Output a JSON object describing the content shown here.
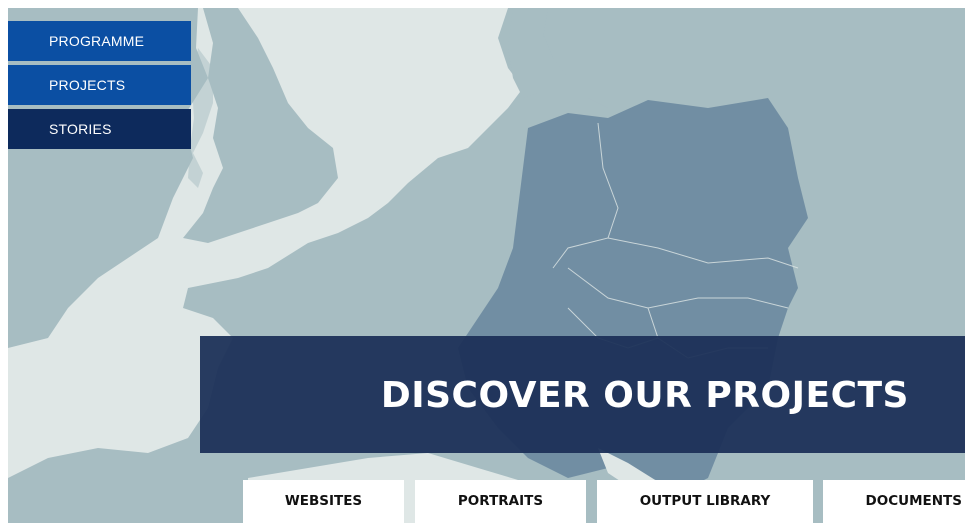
{
  "nav": {
    "items": [
      {
        "label": "PROGRAMME"
      },
      {
        "label": "PROJECTS"
      },
      {
        "label": "STORIES"
      }
    ]
  },
  "hero": {
    "title": "DISCOVER OUR PROJECTS"
  },
  "tabs": [
    {
      "label": "WEBSITES"
    },
    {
      "label": "PORTRAITS"
    },
    {
      "label": "OUTPUT LIBRARY"
    },
    {
      "label": "DOCUMENTS"
    }
  ],
  "colors": {
    "nav_blue": "#0b4fa3",
    "nav_dark": "#0d2a5c",
    "hero_bg": "#1c3057",
    "sea": "#dfe7e6",
    "land": "#a7bdc2",
    "highlight_region": "#718ea3"
  }
}
